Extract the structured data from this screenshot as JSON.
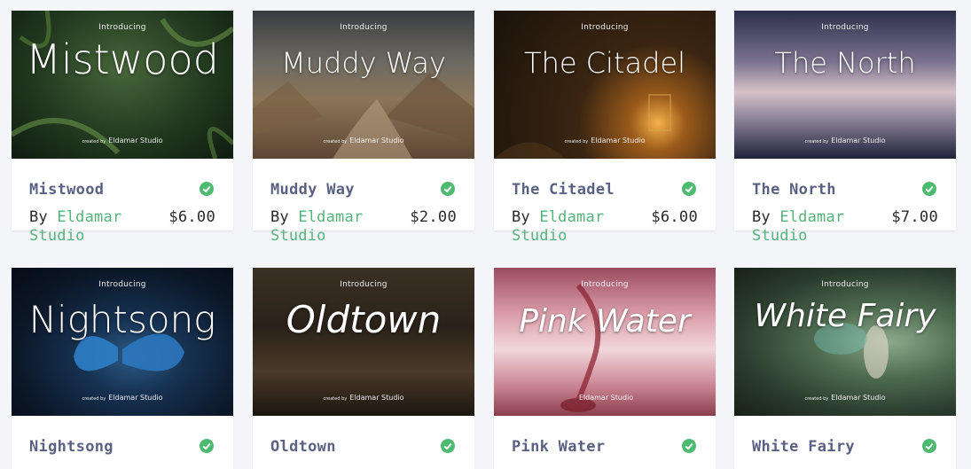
{
  "products": [
    {
      "preview_intro": "Introducing",
      "preview_title": "Mistwood",
      "preview_credit_small": "created by",
      "preview_credit": "Eldamar Studio",
      "name": "Mistwood",
      "by": "By",
      "author": "Eldamar Studio",
      "price": "$6.00",
      "verified_icon": "check-circle-icon",
      "bg": "#1f3320",
      "bg2": "#3d5a2b"
    },
    {
      "preview_intro": "Introducing",
      "preview_title": "Muddy Way",
      "preview_credit_small": "created by",
      "preview_credit": "Eldamar Studio",
      "name": "Muddy Way",
      "by": "By",
      "author": "Eldamar Studio",
      "price": "$2.00",
      "verified_icon": "check-circle-icon",
      "bg": "#4a4038",
      "bg2": "#7a6a58"
    },
    {
      "preview_intro": "Introducing",
      "preview_title": "The Citadel",
      "preview_credit_small": "created by",
      "preview_credit": "Eldamar Studio",
      "name": "The Citadel",
      "by": "By",
      "author": "Eldamar Studio",
      "price": "$6.00",
      "verified_icon": "check-circle-icon",
      "bg": "#2a1c10",
      "bg2": "#6b4a1e"
    },
    {
      "preview_intro": "Introducing",
      "preview_title": "The North",
      "preview_credit_small": "created by",
      "preview_credit": "Eldamar Studio",
      "name": "The North",
      "by": "By",
      "author": "Eldamar Studio",
      "price": "$7.00",
      "verified_icon": "check-circle-icon",
      "bg": "#2a2e45",
      "bg2": "#b9a3b0"
    },
    {
      "preview_intro": "Introducing",
      "preview_title": "Nightsong",
      "preview_credit_small": "created by",
      "preview_credit": "Eldamar Studio",
      "name": "Nightsong",
      "verified_icon": "check-circle-icon",
      "bg": "#0d1a2c",
      "bg2": "#24445e"
    },
    {
      "preview_intro": "Introducing",
      "preview_title": "Oldtown",
      "preview_credit_small": "created by",
      "preview_credit": "Eldamar Studio",
      "name": "Oldtown",
      "verified_icon": "check-circle-icon",
      "bg": "#2e2418",
      "bg2": "#4e3e2c"
    },
    {
      "preview_intro": "Introducing",
      "preview_title": "Pink Water",
      "preview_credit_small": "",
      "preview_credit": "Eldamar Studio",
      "name": "Pink Water",
      "verified_icon": "check-circle-icon",
      "bg": "#b66a78",
      "bg2": "#eac7cd"
    },
    {
      "preview_intro": "Introducing",
      "preview_title": "White Fairy",
      "preview_credit_small": "created by",
      "preview_credit": "Eldamar Studio",
      "name": "White Fairy",
      "verified_icon": "check-circle-icon",
      "bg": "#2a3b2c",
      "bg2": "#5e7d5c"
    }
  ],
  "colors": {
    "accent_green": "#55b479",
    "title": "#5a6183",
    "check": "#4cbb6f"
  }
}
